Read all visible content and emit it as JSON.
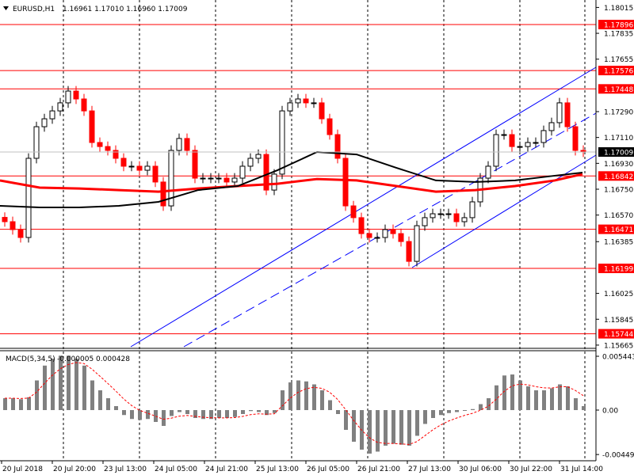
{
  "header": {
    "symbol": "EURUSD,H1",
    "ohlc": "1.16961 1.17010 1.16960 1.17009"
  },
  "colors": {
    "bull": "#000000",
    "bear": "#ff0000",
    "level": "#ff0000",
    "channel": "#0000ff",
    "ma_slow": "#ff0000",
    "ma_fast": "#000000",
    "hist": "#808080",
    "signal": "#ff0000"
  },
  "chart_data": [
    {
      "type": "candlestick",
      "title": "EURUSD,H1",
      "ylim": [
        1.15665,
        1.18015
      ],
      "price_ticks": [
        "1.18015",
        "1.17835",
        "1.17655",
        "1.17290",
        "1.17110",
        "1.16930",
        "1.16750",
        "1.16570",
        "1.16385",
        "1.16025",
        "1.15845",
        "1.15665"
      ],
      "levels": [
        "1.17896",
        "1.17576",
        "1.17448",
        "1.16842",
        "1.16471",
        "1.16199",
        "1.15744"
      ],
      "current_price": "1.17009",
      "x_labels": [
        "20 Jul 2018",
        "20 Jul 20:00",
        "23 Jul 13:00",
        "24 Jul 05:00",
        "24 Jul 21:00",
        "25 Jul 13:00",
        "26 Jul 05:00",
        "26 Jul 21:00",
        "27 Jul 13:00",
        "30 Jul 06:00",
        "30 Jul 22:00",
        "31 Jul 14:00"
      ],
      "closes": [
        1.16524,
        1.16469,
        1.16414,
        1.16965,
        1.17185,
        1.1724,
        1.17295,
        1.17351,
        1.17433,
        1.17378,
        1.17295,
        1.17075,
        1.17047,
        1.1702,
        1.16965,
        1.1691,
        1.1691,
        1.16882,
        1.1691,
        1.168,
        1.16634,
        1.1702,
        1.17103,
        1.1702,
        1.16827,
        1.16827,
        1.16827,
        1.16827,
        1.168,
        1.16827,
        1.1691,
        1.16965,
        1.16992,
        1.16744,
        1.16855,
        1.17295,
        1.17351,
        1.17378,
        1.17351,
        1.17351,
        1.1724,
        1.1713,
        1.16965,
        1.16634,
        1.16552,
        1.16441,
        1.16414,
        1.16414,
        1.16469,
        1.16441,
        1.16386,
        1.16248,
        1.16496,
        1.16552,
        1.16579,
        1.16579,
        1.16579,
        1.16524,
        1.16552,
        1.16662,
        1.16827,
        1.1691,
        1.1713,
        1.1713,
        1.17047,
        1.17047,
        1.17075,
        1.17075,
        1.17158,
        1.17213,
        1.17351,
        1.17185,
        1.1702,
        1.17009
      ],
      "ma_fast": [
        1.16634,
        1.16623,
        1.16623,
        1.16634,
        1.16662,
        1.16744,
        1.16772,
        1.16882,
        1.17009,
        1.16992,
        1.16899,
        1.16811,
        1.168,
        1.16811,
        1.16844,
        1.16866
      ],
      "ma_slow": [
        1.16811,
        1.16761,
        1.16755,
        1.16744,
        1.16733,
        1.16755,
        1.16772,
        1.16788,
        1.16821,
        1.16811,
        1.16772,
        1.16733,
        1.16744,
        1.16772,
        1.16811,
        1.16855
      ]
    },
    {
      "type": "bar",
      "title": "MACD(5,34,5)",
      "values_label": "-0.000005 0.000428",
      "ylim": [
        -0.004494,
        0.005443
      ],
      "ticks": [
        "0.005443",
        "0.00",
        "-0.004494"
      ],
      "histogram": [
        0.0012,
        0.0012,
        0.0011,
        0.0013,
        0.003,
        0.0045,
        0.0052,
        0.0055,
        0.0055,
        0.0052,
        0.0045,
        0.003,
        0.002,
        0.0012,
        0.0004,
        -0.0005,
        -0.0009,
        -0.001,
        -0.0009,
        -0.0012,
        -0.0016,
        -0.0006,
        -0.0002,
        -0.0004,
        -0.0008,
        -0.0009,
        -0.0009,
        -0.0008,
        -0.0008,
        -0.0007,
        -0.0004,
        -0.0001,
        -0.0002,
        -0.0005,
        -0.0003,
        0.002,
        0.0028,
        0.003,
        0.0029,
        0.0026,
        0.002,
        0.001,
        -0.0004,
        -0.002,
        -0.0032,
        -0.004,
        -0.0044,
        -0.0042,
        -0.0036,
        -0.0034,
        -0.0035,
        -0.0036,
        -0.0026,
        -0.0014,
        -0.0008,
        -0.0005,
        -0.0003,
        -0.0002,
        0.0,
        0.0001,
        0.0006,
        0.0012,
        0.0025,
        0.0035,
        0.0036,
        0.003,
        0.0024,
        0.002,
        0.002,
        0.0022,
        0.0026,
        0.0024,
        0.0012,
        0.0004
      ]
    }
  ]
}
